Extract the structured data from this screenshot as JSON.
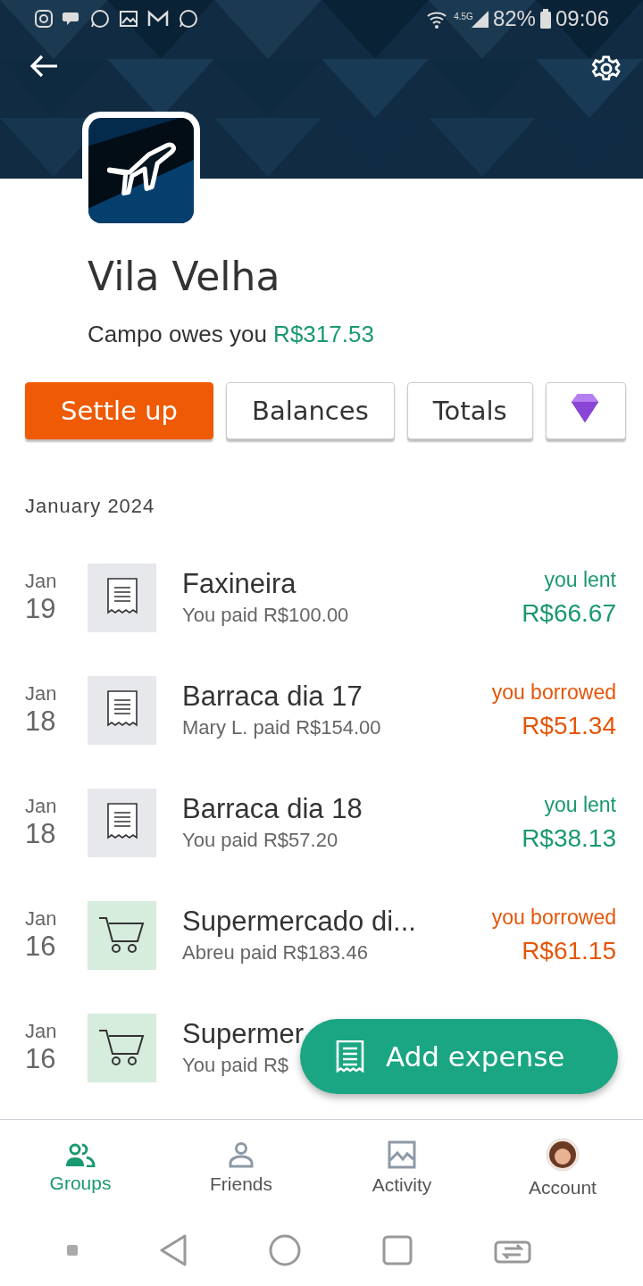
{
  "status_bar": {
    "time": "09:06",
    "battery": "82%",
    "network": "4.5G"
  },
  "group": {
    "name": "Vila Velha",
    "balance_text": "Campo owes you",
    "balance_amount": "R$317.53"
  },
  "actions": [
    {
      "label": "Settle up",
      "kind": "primary"
    },
    {
      "label": "Balances",
      "kind": "secondary"
    },
    {
      "label": "Totals",
      "kind": "secondary"
    },
    {
      "kind": "premium"
    }
  ],
  "section": "January 2024",
  "expenses": [
    {
      "month": "Jan",
      "day": "19",
      "kind": "receipt",
      "title": "Faxineira",
      "subtitle": "You paid R$100.00",
      "color": "#1a9870",
      "label": "you lent",
      "amount": "R$66.67"
    },
    {
      "month": "Jan",
      "day": "18",
      "kind": "receipt",
      "title": "Barraca dia 17",
      "subtitle": "Mary L. paid R$154.00",
      "color": "#e4560a",
      "label": "you borrowed",
      "amount": "R$51.34"
    },
    {
      "month": "Jan",
      "day": "18",
      "kind": "receipt",
      "title": "Barraca dia 18",
      "subtitle": "You paid R$57.20",
      "color": "#1a9870",
      "label": "you lent",
      "amount": "R$38.13"
    },
    {
      "month": "Jan",
      "day": "16",
      "kind": "cart",
      "title": "Supermercado di...",
      "subtitle": "Abreu paid R$183.46",
      "color": "#e4560a",
      "label": "you borrowed",
      "amount": "R$61.15"
    },
    {
      "month": "Jan",
      "day": "16",
      "kind": "cart",
      "title": "Supermer",
      "subtitle": "You paid R$"
    }
  ],
  "fab": {
    "label": "Add expense"
  },
  "nav": [
    {
      "label": "Groups",
      "kind": "groups",
      "selected": true
    },
    {
      "label": "Friends",
      "kind": "person",
      "selected": false
    },
    {
      "label": "Activity",
      "kind": "chart",
      "selected": false
    },
    {
      "label": "Account",
      "kind": "avatar",
      "selected": false
    }
  ]
}
